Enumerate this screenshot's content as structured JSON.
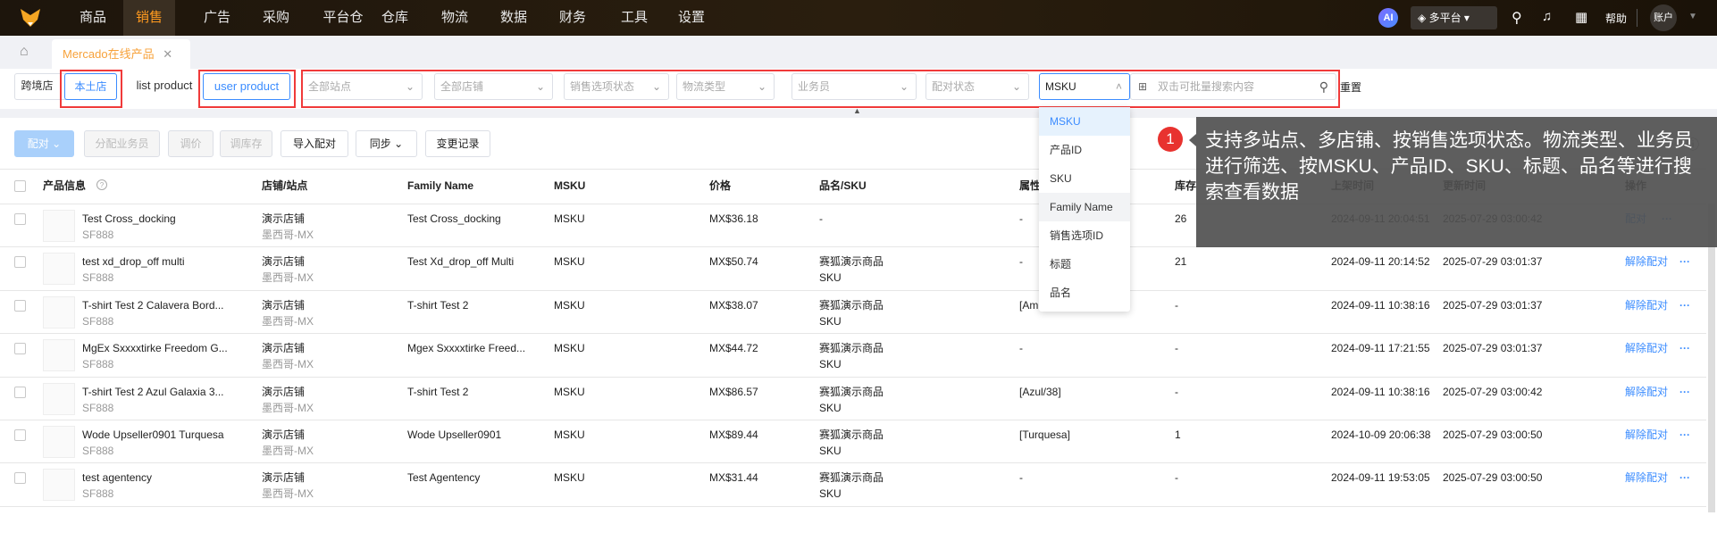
{
  "nav": {
    "items": [
      "商品",
      "销售",
      "广告",
      "采购",
      "平台仓",
      "仓库",
      "物流",
      "数据",
      "财务",
      "工具",
      "设置"
    ],
    "active": "销售",
    "ai": "AI",
    "platform": "多平台",
    "help": "帮助",
    "account": "账户"
  },
  "tabs": {
    "current": "Mercado在线产品"
  },
  "filters": {
    "store_type": [
      "跨境店",
      "本土店"
    ],
    "product_type": [
      "list product",
      "user product"
    ],
    "site": "全部站点",
    "shop": "全部店铺",
    "sale_status": "销售选项状态",
    "logistics": "物流类型",
    "salesperson": "业务员",
    "match_status": "配对状态",
    "search_field": "MSKU",
    "search_placeholder": "双击可批量搜索内容",
    "reset": "重置"
  },
  "search_options": [
    "MSKU",
    "产品ID",
    "SKU",
    "Family Name",
    "销售选项ID",
    "标题",
    "品名"
  ],
  "toolbar": {
    "match": "配对",
    "assign": "分配业务员",
    "price": "调价",
    "stock": "调库存",
    "import": "导入配对",
    "sync": "同步",
    "log": "变更记录"
  },
  "columns": [
    "产品信息",
    "店铺/站点",
    "Family Name",
    "MSKU",
    "价格",
    "品名/SKU",
    "属性",
    "库存",
    "上架时间",
    "更新时间",
    "操作"
  ],
  "rows": [
    {
      "title": "Test Cross_docking",
      "sku": "SF888",
      "shop": "演示店铺",
      "site": "墨西哥-MX",
      "family": "Test Cross_docking",
      "msku": "MSKU",
      "price": "MX$36.18",
      "name": "-",
      "name_sku": "",
      "attr": "-",
      "stock": "26",
      "listed": "2024-09-11 20:04:51",
      "updated": "2025-07-29 03:00:42",
      "action": "配对"
    },
    {
      "title": "test xd_drop_off multi",
      "sku": "SF888",
      "shop": "演示店铺",
      "site": "墨西哥-MX",
      "family": "Test Xd_drop_off Multi",
      "msku": "MSKU",
      "price": "MX$50.74",
      "name": "赛狐演示商品",
      "name_sku": "SKU",
      "attr": "-",
      "stock": "21",
      "listed": "2024-09-11 20:14:52",
      "updated": "2025-07-29 03:01:37",
      "action": "解除配对"
    },
    {
      "title": "T-shirt Test 2 Calavera Bord...",
      "sku": "SF888",
      "shop": "演示店铺",
      "site": "墨西哥-MX",
      "family": "T-shirt Test 2",
      "msku": "MSKU",
      "price": "MX$38.07",
      "name": "赛狐演示商品",
      "name_sku": "SKU",
      "attr": "[Am",
      "stock": "-",
      "listed": "2024-09-11 10:38:16",
      "updated": "2025-07-29 03:01:37",
      "action": "解除配对"
    },
    {
      "title": "MgEx Sxxxxtirke Freedom G...",
      "sku": "SF888",
      "shop": "演示店铺",
      "site": "墨西哥-MX",
      "family": "Mgex Sxxxxtirke Freed...",
      "msku": "MSKU",
      "price": "MX$44.72",
      "name": "赛狐演示商品",
      "name_sku": "SKU",
      "attr": "-",
      "stock": "-",
      "listed": "2024-09-11 17:21:55",
      "updated": "2025-07-29 03:01:37",
      "action": "解除配对"
    },
    {
      "title": "T-shirt Test 2 Azul Galaxia 3...",
      "sku": "SF888",
      "shop": "演示店铺",
      "site": "墨西哥-MX",
      "family": "T-shirt Test 2",
      "msku": "MSKU",
      "price": "MX$86.57",
      "name": "赛狐演示商品",
      "name_sku": "SKU",
      "attr": "[Azul/38]",
      "stock": "-",
      "listed": "2024-09-11 10:38:16",
      "updated": "2025-07-29 03:00:42",
      "action": "解除配对"
    },
    {
      "title": "Wode Upseller0901 Turquesa",
      "sku": "SF888",
      "shop": "演示店铺",
      "site": "墨西哥-MX",
      "family": "Wode Upseller0901",
      "msku": "MSKU",
      "price": "MX$89.44",
      "name": "赛狐演示商品",
      "name_sku": "SKU",
      "attr": "[Turquesa]",
      "stock": "1",
      "listed": "2024-10-09 20:06:38",
      "updated": "2025-07-29 03:00:50",
      "action": "解除配对"
    },
    {
      "title": "test agentency",
      "sku": "SF888",
      "shop": "演示店铺",
      "site": "墨西哥-MX",
      "family": "Test Agentency",
      "msku": "MSKU",
      "price": "MX$31.44",
      "name": "赛狐演示商品",
      "name_sku": "SKU",
      "attr": "-",
      "stock": "-",
      "listed": "2024-09-11 19:53:05",
      "updated": "2025-07-29 03:00:50",
      "action": "解除配对"
    }
  ],
  "tooltip": {
    "step": "1",
    "text": "支持多站点、多店铺、按销售选项状态。物流类型、业务员进行筛选、按MSKU、产品ID、SKU、标题、品名等进行搜索查看数据"
  },
  "colors": {
    "accent": "#ff9a1f",
    "link": "#3b8cff",
    "highlight": "#f03a3a"
  }
}
